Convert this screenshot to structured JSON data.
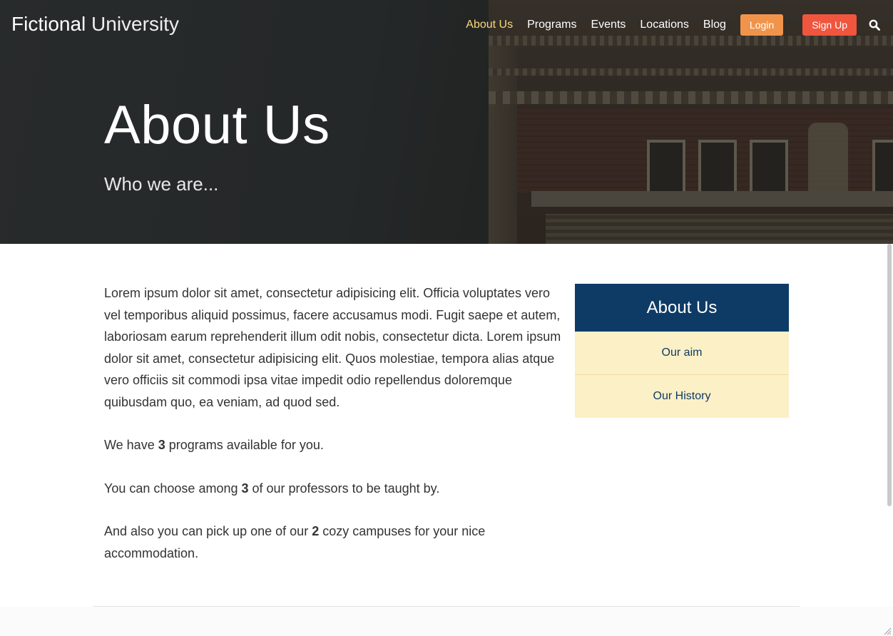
{
  "header": {
    "logo_strong": "Fictional",
    "logo_light": "University",
    "nav": [
      {
        "label": "About Us"
      },
      {
        "label": "Programs"
      },
      {
        "label": "Events"
      },
      {
        "label": "Locations"
      },
      {
        "label": "Blog"
      }
    ],
    "login_label": "Login",
    "signup_label": "Sign Up",
    "search_icon": "search-icon"
  },
  "hero": {
    "title": "About Us",
    "subtitle": "Who we are..."
  },
  "main": {
    "intro": "Lorem ipsum dolor sit amet, consectetur adipisicing elit. Officia voluptates vero vel temporibus aliquid possimus, facere accusamus modi. Fugit saepe et autem, laboriosam earum reprehenderit illum odit nobis, consectetur dicta. Lorem ipsum dolor sit amet, consectetur adipisicing elit. Quos molestiae, tempora alias atque vero officiis sit commodi ipsa vitae impedit odio repellendus doloremque quibusdam quo, ea veniam, ad quod sed.",
    "programs": {
      "pre": "We have ",
      "count": "3",
      "post": " programs available for you."
    },
    "professors": {
      "pre": "You can choose among ",
      "count": "3",
      "post": " of our professors to be taught by."
    },
    "campuses": {
      "pre": "And also you can pick up one of our ",
      "count": "2",
      "post": " cozy campuses for your nice accommodation."
    }
  },
  "sidebar": {
    "title": "About Us",
    "items": [
      {
        "label": "Our aim"
      },
      {
        "label": "Our History"
      }
    ]
  },
  "colors": {
    "nav_active": "#fbd97a",
    "login_button": "#f1944b",
    "signup_button": "#f0553e",
    "sidebar_head": "#0e3b66",
    "sidebar_item": "#fbf0c6"
  }
}
